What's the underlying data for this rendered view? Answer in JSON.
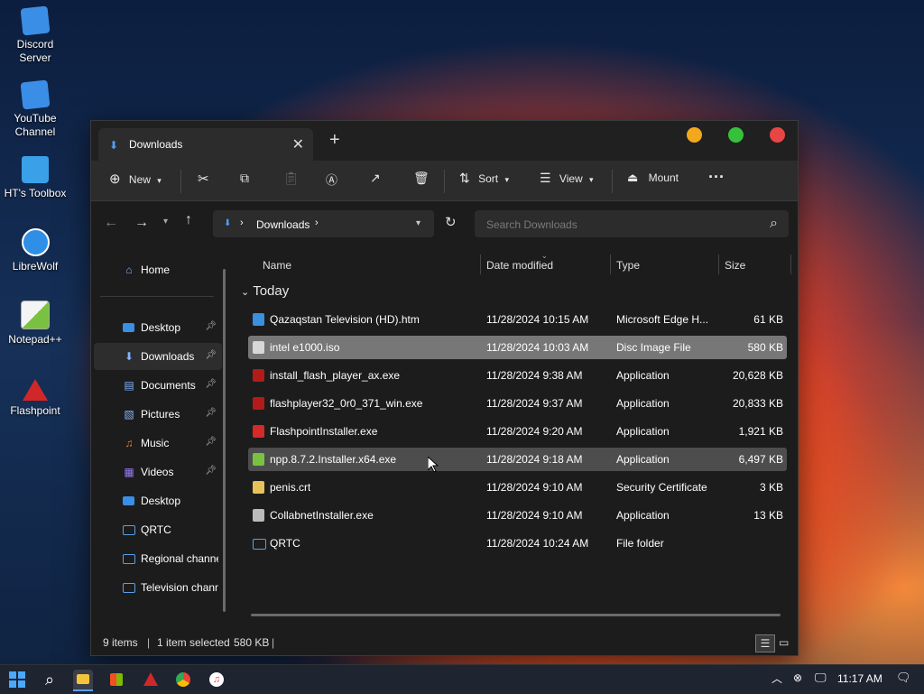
{
  "desktop": {
    "icons": [
      {
        "label": "Discord Server",
        "icon": "web-shortcut-icon",
        "color": "#3a8ee6"
      },
      {
        "label": "YouTube Channel",
        "icon": "web-shortcut-icon",
        "color": "#3a8ee6"
      },
      {
        "label": "HT's Toolbox",
        "icon": "folder-icon",
        "color": "#3aa0e8"
      },
      {
        "label": "LibreWolf",
        "icon": "librewolf-icon",
        "color": "#2f8fe6"
      },
      {
        "label": "Notepad++",
        "icon": "notepadpp-icon",
        "color": "#7ac142"
      },
      {
        "label": "Flashpoint",
        "icon": "flashpoint-icon",
        "color": "#d02828"
      }
    ]
  },
  "window": {
    "tab_title": "Downloads",
    "controls": {
      "minimize": "#f2a81c",
      "maximize": "#35c23a",
      "close": "#e84545"
    }
  },
  "toolbar": {
    "new_label": "New",
    "sort_label": "Sort",
    "view_label": "View",
    "mount_label": "Mount",
    "more_label": "···"
  },
  "address": {
    "breadcrumb": "Downloads",
    "search_placeholder": "Search Downloads"
  },
  "nav": {
    "home": "Home",
    "items": [
      {
        "label": "Desktop",
        "pinned": true
      },
      {
        "label": "Downloads",
        "pinned": true,
        "selected": true
      },
      {
        "label": "Documents",
        "pinned": true
      },
      {
        "label": "Pictures",
        "pinned": true
      },
      {
        "label": "Music",
        "pinned": true
      },
      {
        "label": "Videos",
        "pinned": true
      },
      {
        "label": "Desktop",
        "pinned": false
      },
      {
        "label": "QRTC",
        "pinned": false
      },
      {
        "label": "Regional channels",
        "pinned": false
      },
      {
        "label": "Television channels",
        "pinned": false
      }
    ]
  },
  "columns": {
    "name": "Name",
    "date": "Date modified",
    "type": "Type",
    "size": "Size"
  },
  "group_label": "Today",
  "files": [
    {
      "name": "Qazaqstan Television (HD).htm",
      "date": "11/28/2024 10:15 AM",
      "type": "Microsoft Edge H...",
      "size": "61 KB",
      "icon": "edge-html-icon",
      "color": "#3b8fe0"
    },
    {
      "name": "intel e1000.iso",
      "date": "11/28/2024 10:03 AM",
      "type": "Disc Image File",
      "size": "580 KB",
      "icon": "iso-file-icon",
      "color": "#d8d8d8",
      "selected": true
    },
    {
      "name": "install_flash_player_ax.exe",
      "date": "11/28/2024 9:38 AM",
      "type": "Application",
      "size": "20,628 KB",
      "icon": "flash-exe-icon",
      "color": "#b31b1b"
    },
    {
      "name": "flashplayer32_0r0_371_win.exe",
      "date": "11/28/2024 9:37 AM",
      "type": "Application",
      "size": "20,833 KB",
      "icon": "flash-exe-icon",
      "color": "#b31b1b"
    },
    {
      "name": "FlashpointInstaller.exe",
      "date": "11/28/2024 9:20 AM",
      "type": "Application",
      "size": "1,921 KB",
      "icon": "flashpoint-exe-icon",
      "color": "#d42a2a"
    },
    {
      "name": "npp.8.7.2.Installer.x64.exe",
      "date": "11/28/2024 9:18 AM",
      "type": "Application",
      "size": "6,497 KB",
      "icon": "npp-installer-icon",
      "color": "#7ac142",
      "hover": true
    },
    {
      "name": "penis.crt",
      "date": "11/28/2024 9:10 AM",
      "type": "Security Certificate",
      "size": "3 KB",
      "icon": "certificate-icon",
      "color": "#e6c35a"
    },
    {
      "name": "CollabnetInstaller.exe",
      "date": "11/28/2024 9:10 AM",
      "type": "Application",
      "size": "13 KB",
      "icon": "exe-icon",
      "color": "#bbbbbb"
    },
    {
      "name": "QRTC",
      "date": "11/28/2024 10:24 AM",
      "type": "File folder",
      "size": "",
      "icon": "folder-icon",
      "color": "#5aa0e8"
    }
  ],
  "status": {
    "count": "9 items",
    "selected": "1 item selected",
    "size": "580 KB"
  },
  "taskbar": {
    "time": "11:17 AM"
  }
}
